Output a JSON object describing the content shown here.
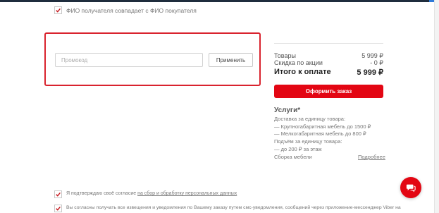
{
  "recipient_same_label": "ФИО получателя совпадает с ФИО покупателя",
  "promo": {
    "placeholder": "Промокод",
    "apply_label": "Применить"
  },
  "summary": {
    "goods_label": "Товары",
    "goods_value": "5 999 ₽",
    "discount_label": "Скидка по акции",
    "discount_value": "- 0 ₽",
    "total_label": "Итого к оплате",
    "total_value": "5 999 ₽"
  },
  "order_button_label": "Оформить заказ",
  "services": {
    "title": "Услуги*",
    "lines": [
      "Доставка за единицу товара:",
      "— Крупногабаритная мебель до 1500 ₽",
      "— Мелкогабаритная мебель до 800 ₽",
      "Подъём за единицу товара:",
      "— до 200 ₽ за этаж",
      "Сборка мебели"
    ],
    "more_label": "Подробнее"
  },
  "consent": {
    "text": "Я подтверждаю своё согласие",
    "link": "на сбор и обработку персональных данных"
  },
  "notifications_text": "Вы согласны получать все извещения и уведомления по Вашему заказу путем смс-уведомления, сообщений через приложение-мессенджер Viber на",
  "colors": {
    "accent": "#e30613",
    "highlight_frame": "#d9232e",
    "checkmark": "#c4161c"
  }
}
